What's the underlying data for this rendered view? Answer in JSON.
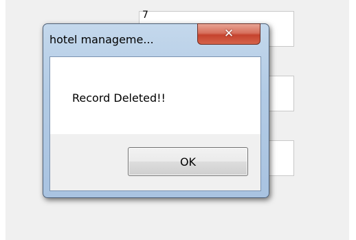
{
  "parent_window": {
    "field_1_value": "7"
  },
  "dialog": {
    "title": "hotel manageme...",
    "message": "Record Deleted!!",
    "ok_label": "OK",
    "close_icon": "close-icon"
  },
  "colors": {
    "close_button": "#c5432e",
    "frame": "#b2cbe5",
    "footer": "#f0f0f0"
  }
}
